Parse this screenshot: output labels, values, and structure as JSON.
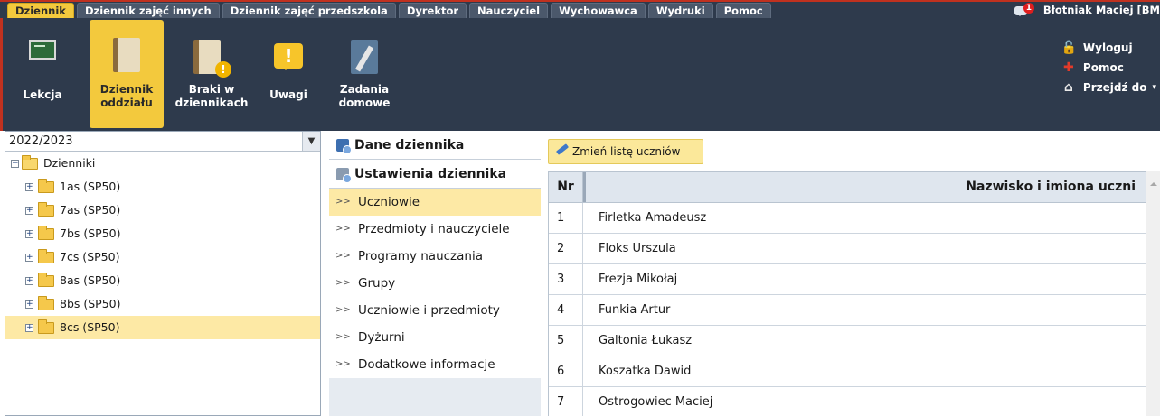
{
  "menu": {
    "tabs": [
      "Dziennik",
      "Dziennik zajęć innych",
      "Dziennik zajęć przedszkola",
      "Dyrektor",
      "Nauczyciel",
      "Wychowawca",
      "Wydruki",
      "Pomoc"
    ],
    "active_tab": "Dziennik",
    "messages_badge": "1",
    "user": "Błotniak Maciej [BM"
  },
  "toolbar": {
    "buttons": [
      {
        "label_line1": "Lekcja",
        "label_line2": ""
      },
      {
        "label_line1": "Dziennik",
        "label_line2": "oddziału"
      },
      {
        "label_line1": "Braki w",
        "label_line2": "dziennikach"
      },
      {
        "label_line1": "Uwagi",
        "label_line2": ""
      },
      {
        "label_line1": "Zadania",
        "label_line2": "domowe"
      }
    ],
    "active_button": "Dziennik oddziału",
    "links": [
      "Wyloguj",
      "Pomoc",
      "Przejdź do"
    ]
  },
  "tree": {
    "year": "2022/2023",
    "root": "Dzienniki",
    "items": [
      "1as (SP50)",
      "7as (SP50)",
      "7bs (SP50)",
      "7cs (SP50)",
      "8as (SP50)",
      "8bs (SP50)",
      "8cs (SP50)"
    ],
    "selected": "8cs (SP50)"
  },
  "nav": {
    "header1": "Dane dziennika",
    "header2": "Ustawienia dziennika",
    "items": [
      "Uczniowie",
      "Przedmioty i nauczyciele",
      "Programy nauczania",
      "Grupy",
      "Uczniowie i przedmioty",
      "Dyżurni",
      "Dodatkowe informacje"
    ],
    "selected": "Uczniowie"
  },
  "content": {
    "change_button": "Zmień listę uczniów",
    "columns": {
      "nr": "Nr",
      "name": "Nazwisko i imiona uczni"
    },
    "rows": [
      {
        "nr": "1",
        "name": "Firletka Amadeusz"
      },
      {
        "nr": "2",
        "name": "Floks Urszula"
      },
      {
        "nr": "3",
        "name": "Frezja Mikołaj"
      },
      {
        "nr": "4",
        "name": "Funkia Artur"
      },
      {
        "nr": "5",
        "name": "Galtonia Łukasz"
      },
      {
        "nr": "6",
        "name": "Koszatka Dawid"
      },
      {
        "nr": "7",
        "name": "Ostrogowiec Maciej"
      }
    ]
  }
}
